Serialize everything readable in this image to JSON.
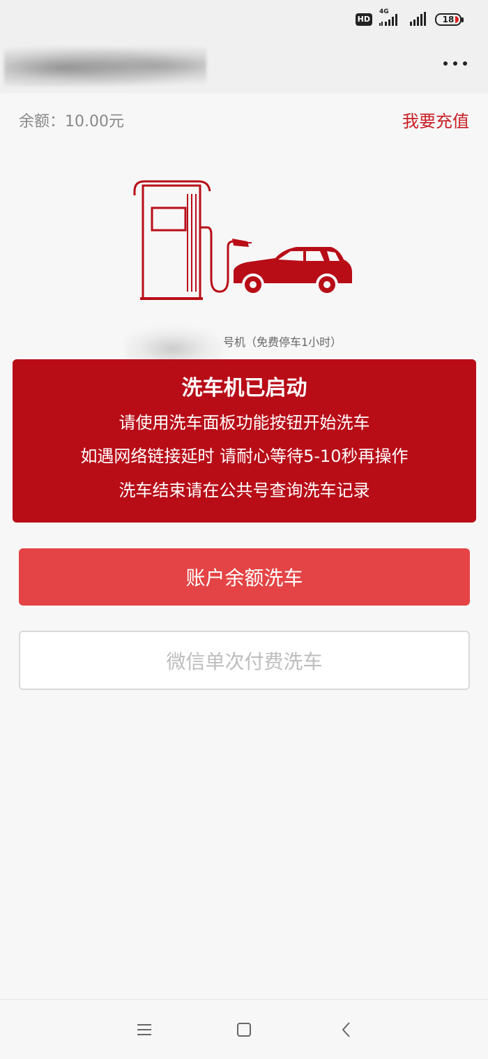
{
  "status_bar": {
    "hd_badge": "HD",
    "network": "4G",
    "battery_level": "18",
    "icons": [
      "hd-icon",
      "signal-icon",
      "signal-icon",
      "battery-icon"
    ]
  },
  "nav": {
    "more_icon": "more-icon"
  },
  "balance": {
    "text": "余额：10.00元",
    "recharge_label": "我要充值"
  },
  "machine": {
    "label": "号机（免费停车1小时）",
    "illustration_icon": "car-wash-machine-icon"
  },
  "notice": {
    "title": "洗车机已启动",
    "lines": [
      "请使用洗车面板功能按钮开始洗车",
      "如遇网络链接延时 请耐心等待5-10秒再操作",
      "洗车结束请在公共号查询洗车记录"
    ]
  },
  "actions": {
    "balance_wash_label": "账户余额洗车",
    "wechat_wash_label": "微信单次付费洗车"
  },
  "system_nav": {
    "icons": [
      "menu-icon",
      "home-icon",
      "back-icon"
    ]
  },
  "colors": {
    "accent": "#c81e24",
    "notice_bg": "#b80c17",
    "primary_button": "#e44445"
  }
}
